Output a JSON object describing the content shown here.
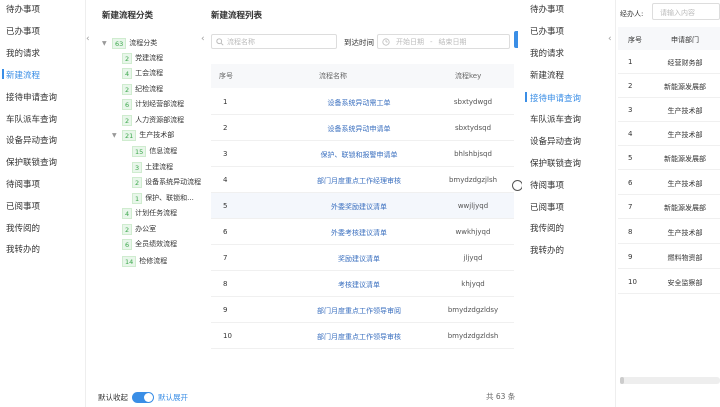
{
  "left_nav": {
    "items": [
      "待办事项",
      "已办事项",
      "我的请求",
      "新建流程",
      "接待申请查询",
      "车队派车查询",
      "设备异动查询",
      "保护联锁查询",
      "待阅事项",
      "已阅事项",
      "我传阅的",
      "我转办的"
    ],
    "active_index": 3
  },
  "tree_panel": {
    "title": "新建流程分类",
    "nodes": [
      {
        "count": "63",
        "label": "流程分类",
        "toggle": "▼"
      },
      {
        "count": "2",
        "label": "党建流程"
      },
      {
        "count": "4",
        "label": "工会流程"
      },
      {
        "count": "2",
        "label": "纪检流程"
      },
      {
        "count": "6",
        "label": "计划经营部流程"
      },
      {
        "count": "2",
        "label": "人力资源部流程"
      },
      {
        "count": "21",
        "label": "生产技术部",
        "toggle": "▼"
      },
      {
        "count": "15",
        "label": "信息流程"
      },
      {
        "count": "3",
        "label": "土建流程"
      },
      {
        "count": "2",
        "label": "设备系统异动流程"
      },
      {
        "count": "1",
        "label": "保护、联锁和..."
      },
      {
        "count": "4",
        "label": "计划任务流程"
      },
      {
        "count": "2",
        "label": "办公室"
      },
      {
        "count": "6",
        "label": "全员绩效流程"
      },
      {
        "count": "14",
        "label": "检修流程"
      }
    ],
    "switch_off_label": "默认收起",
    "switch_on_label": "默认展开"
  },
  "main": {
    "title": "新建流程列表",
    "search_placeholder": "流程名称",
    "date_label": "到达时间",
    "start_placeholder": "开始日期",
    "date_sep": "-",
    "end_placeholder": "结束日期",
    "columns": [
      "序号",
      "流程名称",
      "流程key"
    ],
    "rows": [
      {
        "idx": "1",
        "name": "设备系统异动需工单",
        "key": "sbxtydwgd"
      },
      {
        "idx": "2",
        "name": "设备系统异动申请单",
        "key": "sbxtydsqd"
      },
      {
        "idx": "3",
        "name": "保护、联锁和报警申请单",
        "key": "bhlshbjsqd"
      },
      {
        "idx": "4",
        "name": "部门月度重点工作经理审核",
        "key": "bmydzdgzjlsh"
      },
      {
        "idx": "5",
        "name": "外委奖励建议清单",
        "key": "wwjljyqd"
      },
      {
        "idx": "6",
        "name": "外委考核建议清单",
        "key": "wwkhjyqd"
      },
      {
        "idx": "7",
        "name": "奖励建议清单",
        "key": "jljyqd"
      },
      {
        "idx": "8",
        "name": "考核建议清单",
        "key": "khjyqd"
      },
      {
        "idx": "9",
        "name": "部门月度重点工作领导审阅",
        "key": "bmydzdgzldsy"
      },
      {
        "idx": "10",
        "name": "部门月度重点工作领导审核",
        "key": "bmydzdgzldsh"
      }
    ],
    "highlighted_row": 5,
    "total": "共 63 条"
  },
  "nav2": {
    "items": [
      "待办事项",
      "已办事项",
      "我的请求",
      "新建流程",
      "接待申请查询",
      "车队派车查询",
      "设备异动查询",
      "保护联锁查询",
      "待阅事项",
      "已阅事项",
      "我传阅的",
      "我转办的"
    ],
    "active_index": 4
  },
  "right_panel": {
    "agent_label": "经办人:",
    "agent_placeholder": "请输入内容",
    "columns": [
      "序号",
      "申请部门"
    ],
    "rows": [
      {
        "idx": "1",
        "dept": "经营财务部"
      },
      {
        "idx": "2",
        "dept": "新能源发展部"
      },
      {
        "idx": "3",
        "dept": "生产技术部"
      },
      {
        "idx": "4",
        "dept": "生产技术部"
      },
      {
        "idx": "5",
        "dept": "新能源发展部"
      },
      {
        "idx": "6",
        "dept": "生产技术部"
      },
      {
        "idx": "7",
        "dept": "新能源发展部"
      },
      {
        "idx": "8",
        "dept": "生产技术部"
      },
      {
        "idx": "9",
        "dept": "燃料物资部"
      },
      {
        "idx": "10",
        "dept": "安全监察部"
      }
    ]
  },
  "icons": {
    "collapse": "chevron-left-icon",
    "search": "search-icon",
    "calendar": "calendar-icon",
    "tree_toggle": "caret-down-icon"
  },
  "colors": {
    "accent": "#3a8ee6",
    "count_green": "#3aa64a",
    "link": "#3a6fbf"
  }
}
